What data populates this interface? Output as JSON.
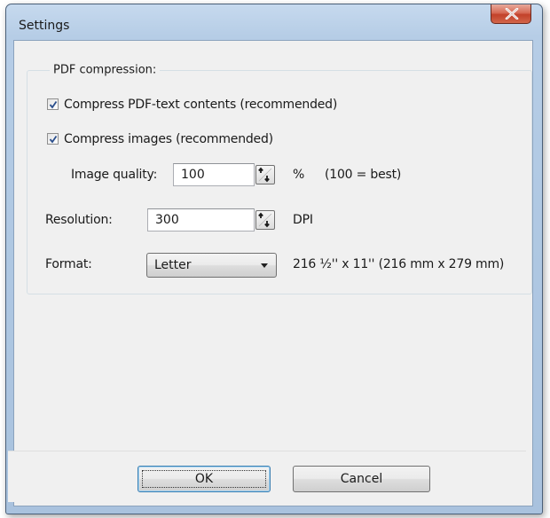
{
  "window": {
    "title": "Settings"
  },
  "group": {
    "legend": "PDF compression:"
  },
  "compress_text": {
    "label": "Compress PDF-text contents (recommended)",
    "checked": true
  },
  "compress_images": {
    "label": "Compress images (recommended)",
    "checked": true
  },
  "image_quality": {
    "label": "Image quality:",
    "value": "100",
    "unit": "%",
    "hint": "(100 = best)"
  },
  "resolution": {
    "label": "Resolution:",
    "value": "300",
    "unit": "DPI"
  },
  "format": {
    "label": "Format:",
    "selected": "Letter",
    "dimensions": "216 ½'' x 11'' (216 mm x 279 mm)"
  },
  "buttons": {
    "ok": "OK",
    "cancel": "Cancel"
  },
  "icons": {
    "close": "close-icon",
    "spin": "spin-arrows-icon",
    "dropdown": "chevron-down-icon",
    "check": "checkmark-icon"
  },
  "colors": {
    "title_bar": "#b6cde6",
    "close_button": "#c2412a",
    "dialog_background": "#f0f0f0",
    "check_mark": "#2a4e8c"
  }
}
